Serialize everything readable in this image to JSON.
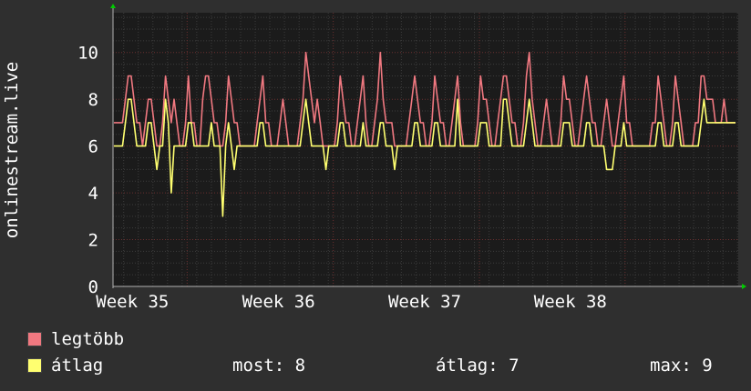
{
  "chart_data": {
    "type": "line",
    "ylabel": "onlinestream.live",
    "ylim": [
      0,
      11.7
    ],
    "yticks": [
      0,
      2,
      4,
      6,
      8,
      10
    ],
    "x_tick_labels": [
      "Week 35",
      "Week 36",
      "Week 37",
      "Week 38"
    ],
    "x_tick_positions": [
      0.125,
      0.413,
      0.701,
      0.988
    ],
    "x_range": [
      -0.021,
      1.211
    ],
    "grid": true,
    "colors": {
      "background": "#2f2f2f",
      "plot_bg": "#1b1b1b",
      "grid_minor": "#3c3c3c",
      "grid_major": "#6a2f2f",
      "axis": "#b0b0b0",
      "text": "#ffffff",
      "arrow": "#00cc00"
    },
    "series": [
      {
        "name": "legtöbb",
        "color": "#f07880",
        "values": [
          7,
          7,
          7,
          7,
          8,
          9,
          9,
          8,
          7,
          7,
          6,
          7,
          8,
          8,
          7,
          6,
          6,
          7,
          9,
          8,
          7,
          8,
          7,
          6,
          6,
          7,
          9,
          7,
          7,
          6,
          6,
          8,
          9,
          9,
          8,
          7,
          7,
          6,
          6,
          7,
          9,
          8,
          7,
          7,
          6,
          6,
          6,
          6,
          6,
          6,
          7,
          8,
          9,
          7,
          7,
          6,
          6,
          6,
          7,
          8,
          7,
          6,
          6,
          6,
          6,
          7,
          8,
          10,
          9,
          8,
          7,
          8,
          7,
          6,
          6,
          6,
          6,
          6,
          7,
          9,
          8,
          7,
          7,
          6,
          6,
          7,
          8,
          9,
          7,
          6,
          6,
          7,
          8,
          10,
          8,
          7,
          7,
          7,
          6,
          6,
          6,
          6,
          6,
          7,
          8,
          9,
          8,
          7,
          7,
          6,
          6,
          7,
          9,
          8,
          7,
          7,
          6,
          6,
          7,
          8,
          9,
          7,
          6,
          6,
          6,
          6,
          6,
          7,
          9,
          8,
          8,
          7,
          6,
          6,
          7,
          8,
          9,
          9,
          8,
          7,
          7,
          6,
          6,
          7,
          9,
          10,
          8,
          7,
          6,
          6,
          7,
          8,
          7,
          6,
          6,
          6,
          7,
          9,
          8,
          8,
          7,
          6,
          6,
          7,
          8,
          9,
          8,
          7,
          7,
          6,
          6,
          7,
          8,
          7,
          6,
          6,
          7,
          8,
          9,
          7,
          7,
          6,
          6,
          6,
          6,
          6,
          6,
          6,
          7,
          7,
          9,
          8,
          7,
          6,
          6,
          7,
          9,
          8,
          7,
          6,
          6,
          6,
          6,
          7,
          7,
          9,
          9,
          8,
          8,
          8,
          7,
          7,
          7,
          8,
          7,
          7,
          7,
          7
        ]
      },
      {
        "name": "átlag",
        "color": "#ffff70",
        "values": [
          6,
          6,
          6,
          6,
          7,
          8,
          8,
          7,
          6,
          6,
          6,
          6,
          7,
          7,
          6,
          5,
          6,
          6,
          8,
          7,
          4,
          6,
          6,
          6,
          6,
          6,
          7,
          7,
          6,
          6,
          6,
          6,
          6,
          6,
          7,
          6,
          6,
          6,
          3,
          6,
          7,
          6,
          5,
          6,
          6,
          6,
          6,
          6,
          6,
          6,
          6,
          7,
          7,
          6,
          6,
          6,
          6,
          6,
          6,
          6,
          6,
          6,
          6,
          6,
          6,
          6,
          7,
          8,
          7,
          6,
          6,
          6,
          6,
          6,
          5,
          6,
          6,
          6,
          6,
          7,
          7,
          6,
          6,
          6,
          6,
          6,
          6,
          7,
          6,
          6,
          6,
          6,
          6,
          7,
          7,
          6,
          6,
          6,
          5,
          6,
          6,
          6,
          6,
          6,
          6,
          7,
          7,
          6,
          6,
          6,
          6,
          6,
          7,
          7,
          6,
          6,
          6,
          6,
          6,
          6,
          8,
          6,
          6,
          6,
          6,
          6,
          6,
          6,
          7,
          7,
          7,
          6,
          6,
          6,
          6,
          6,
          8,
          8,
          7,
          6,
          6,
          6,
          6,
          6,
          7,
          8,
          7,
          6,
          6,
          6,
          6,
          6,
          6,
          6,
          6,
          6,
          6,
          7,
          7,
          7,
          6,
          6,
          6,
          6,
          6,
          7,
          7,
          6,
          6,
          6,
          6,
          6,
          5,
          5,
          5,
          6,
          6,
          6,
          7,
          6,
          6,
          6,
          6,
          6,
          6,
          6,
          6,
          6,
          6,
          6,
          7,
          7,
          6,
          6,
          6,
          6,
          7,
          7,
          6,
          6,
          6,
          6,
          6,
          6,
          6,
          7,
          8,
          7,
          7,
          7,
          7,
          7,
          7,
          7,
          7,
          7,
          7,
          7
        ]
      }
    ]
  },
  "legend": {
    "max_label": "legtöbb",
    "avg_label": "átlag"
  },
  "stats": {
    "now": "most: 8",
    "avg": "átlag: 7",
    "max": "max: 9"
  }
}
